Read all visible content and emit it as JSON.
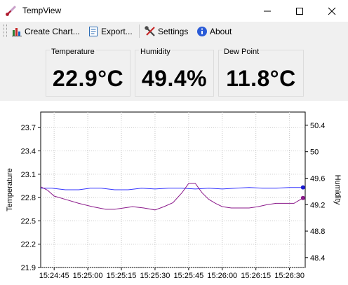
{
  "window": {
    "title": "TempView",
    "icon": "thermometer-icon"
  },
  "toolbar": {
    "items": [
      {
        "label": "Create Chart...",
        "icon": "chart-icon"
      },
      {
        "label": "Export...",
        "icon": "document-icon"
      },
      {
        "label": "Settings",
        "icon": "tools-icon"
      },
      {
        "label": "About",
        "icon": "info-icon"
      }
    ]
  },
  "readouts": {
    "temperature": {
      "label": "Temperature",
      "value": "22.9°C"
    },
    "humidity": {
      "label": "Humidity",
      "value": "49.4%"
    },
    "dewpoint": {
      "label": "Dew Point",
      "value": "11.8°C"
    }
  },
  "colors": {
    "temperature_line": "#3333ff",
    "humidity_line": "#8b1a8b",
    "grid": "#c8c8c8"
  },
  "chart_data": {
    "type": "line",
    "title": "",
    "xlabel": "",
    "ylabel": "Temperature",
    "y2label": "Humidity",
    "x_ticks": [
      "15:24:45",
      "15:25:00",
      "15:25:15",
      "15:25:30",
      "15:25:45",
      "15:26:00",
      "15:26:15",
      "15:26:30"
    ],
    "xlim": [
      "15:24:39",
      "15:26:37"
    ],
    "y_ticks": [
      "21.9",
      "22.2",
      "22.5",
      "22.8",
      "23.1",
      "23.4",
      "23.7"
    ],
    "ylim": [
      21.9,
      23.9
    ],
    "y2_ticks": [
      "48.4",
      "48.8",
      "49.2",
      "49.6",
      "50",
      "50.4"
    ],
    "y2lim": [
      48.25,
      50.6
    ],
    "grid": true,
    "series": [
      {
        "name": "Temperature",
        "axis": "left",
        "x": [
          "15:24:39",
          "15:24:44",
          "15:24:50",
          "15:24:56",
          "15:25:01",
          "15:25:06",
          "15:25:12",
          "15:25:18",
          "15:25:24",
          "15:25:30",
          "15:25:36",
          "15:25:42",
          "15:25:48",
          "15:25:54",
          "15:26:00",
          "15:26:06",
          "15:26:12",
          "15:26:18",
          "15:26:24",
          "15:26:30",
          "15:26:36"
        ],
        "values": [
          22.92,
          22.92,
          22.9,
          22.9,
          22.92,
          22.92,
          22.9,
          22.9,
          22.92,
          22.91,
          22.92,
          22.92,
          22.91,
          22.92,
          22.91,
          22.92,
          22.93,
          22.92,
          22.92,
          22.93,
          22.93
        ]
      },
      {
        "name": "Humidity",
        "axis": "right",
        "x": [
          "15:24:39",
          "15:24:42",
          "15:24:45",
          "15:24:50",
          "15:24:56",
          "15:25:02",
          "15:25:08",
          "15:25:12",
          "15:25:16",
          "15:25:20",
          "15:25:25",
          "15:25:30",
          "15:25:34",
          "15:25:38",
          "15:25:42",
          "15:25:45",
          "15:25:48",
          "15:25:51",
          "15:25:54",
          "15:25:57",
          "15:26:00",
          "15:26:04",
          "15:26:08",
          "15:26:12",
          "15:26:16",
          "15:26:20",
          "15:26:24",
          "15:26:28",
          "15:26:32",
          "15:26:36"
        ],
        "values": [
          49.47,
          49.42,
          49.33,
          49.28,
          49.22,
          49.17,
          49.13,
          49.13,
          49.15,
          49.17,
          49.15,
          49.12,
          49.17,
          49.23,
          49.38,
          49.52,
          49.52,
          49.38,
          49.28,
          49.22,
          49.17,
          49.15,
          49.15,
          49.15,
          49.17,
          49.2,
          49.22,
          49.22,
          49.22,
          49.3
        ]
      }
    ]
  }
}
